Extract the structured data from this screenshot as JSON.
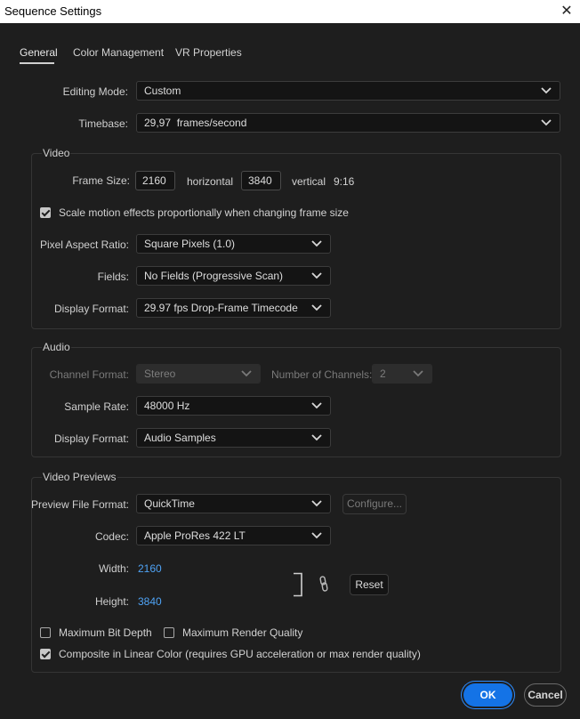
{
  "window": {
    "title": "Sequence Settings",
    "close_icon": "close-icon"
  },
  "tabs": [
    {
      "label": "General",
      "active": true
    },
    {
      "label": "Color Management",
      "active": false
    },
    {
      "label": "VR Properties",
      "active": false
    }
  ],
  "general": {
    "editing_mode_label": "Editing Mode:",
    "editing_mode_value": "Custom",
    "timebase_label": "Timebase:",
    "timebase_value": "29,97  frames/second"
  },
  "video": {
    "title": "Video",
    "frame_size_label": "Frame Size:",
    "width_value": "2160",
    "horizontal_label": "horizontal",
    "height_value": "3840",
    "vertical_label": "vertical",
    "aspect": "9:16",
    "scale_checkbox_label": "Scale motion effects proportionally when changing frame size",
    "scale_checked": true,
    "pixel_aspect_label": "Pixel Aspect Ratio:",
    "pixel_aspect_value": "Square Pixels (1.0)",
    "fields_label": "Fields:",
    "fields_value": "No Fields (Progressive Scan)",
    "display_format_label": "Display Format:",
    "display_format_value": "29.97 fps Drop-Frame Timecode"
  },
  "audio": {
    "title": "Audio",
    "channel_format_label": "Channel Format:",
    "channel_format_value": "Stereo",
    "num_channels_label": "Number of Channels:",
    "num_channels_value": "2",
    "sample_rate_label": "Sample Rate:",
    "sample_rate_value": "48000 Hz",
    "display_format_label": "Display Format:",
    "display_format_value": "Audio Samples"
  },
  "previews": {
    "title": "Video Previews",
    "preview_format_label": "Preview File Format:",
    "preview_format_value": "QuickTime",
    "configure_label": "Configure...",
    "codec_label": "Codec:",
    "codec_value": "Apple ProRes 422 LT",
    "width_label": "Width:",
    "width_value": "2160",
    "height_label": "Height:",
    "height_value": "3840",
    "reset_label": "Reset",
    "max_bit_depth_label": "Maximum Bit Depth",
    "max_bit_depth_checked": false,
    "max_render_label": "Maximum Render Quality",
    "max_render_checked": false,
    "composite_label": "Composite in Linear Color (requires GPU acceleration or max render quality)",
    "composite_checked": true
  },
  "buttons": {
    "ok": "OK",
    "cancel": "Cancel"
  },
  "colors": {
    "accent": "#1473e6",
    "link_value": "#4fa3f5",
    "background": "#1e1e1e"
  }
}
